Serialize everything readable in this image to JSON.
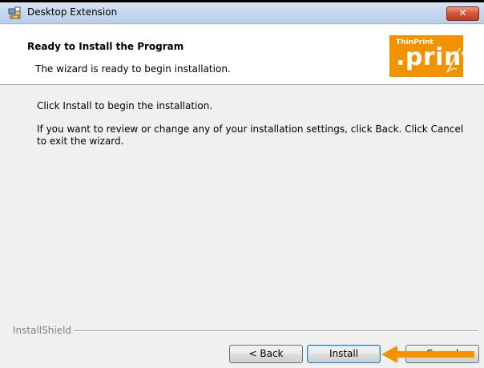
{
  "window": {
    "title": "Desktop Extension",
    "close_label": "✕"
  },
  "header": {
    "title": "Ready to Install the Program",
    "subtitle": "The wizard is ready to begin installation.",
    "logo_small": "ThinPrint",
    "logo_big": ".print"
  },
  "content": {
    "line1": "Click Install to begin the installation.",
    "line2": "If you want to review or change any of your installation settings, click Back. Click Cancel to exit the wizard."
  },
  "footer": {
    "brand": "InstallShield"
  },
  "buttons": {
    "back": "< Back",
    "install": "Install",
    "cancel": "Cancel"
  },
  "colors": {
    "logo": "#f39200",
    "arrow": "#f39200",
    "close": "#c13c1f"
  },
  "icons": {
    "app": "installer-icon",
    "close": "close-icon",
    "annotation": "arrow-left-icon"
  }
}
